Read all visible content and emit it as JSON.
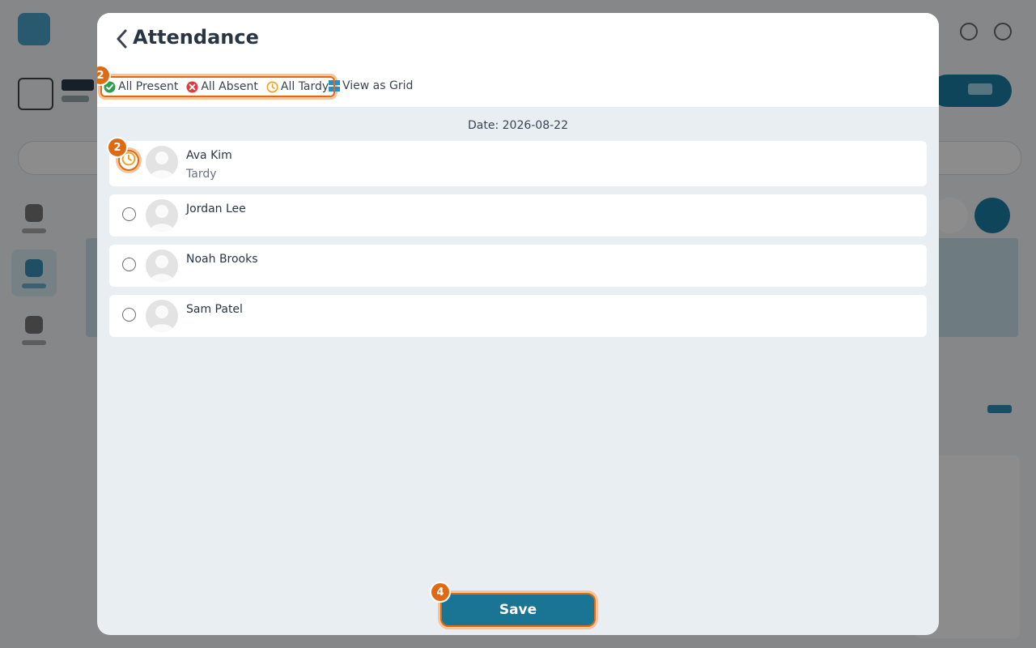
{
  "modal": {
    "title": "Attendance",
    "toolbar": {
      "all_present": "All Present",
      "all_absent": "All Absent",
      "all_tardy": "All Tardy",
      "view_as_grid": "View as Grid",
      "step_badge": "2"
    },
    "date_label": "Date: 2026-08-22",
    "students": [
      {
        "name": "Ava Kim",
        "status": "Tardy",
        "badge": "2"
      },
      {
        "name": "Jordan Lee",
        "status": ""
      },
      {
        "name": "Noah Brooks",
        "status": ""
      },
      {
        "name": "Sam Patel",
        "status": ""
      }
    ],
    "save_label": "Save",
    "save_badge": "4"
  },
  "icons": {
    "back": "chevron-left-icon",
    "present": "check-circle-icon",
    "absent": "x-circle-icon",
    "tardy": "clock-icon",
    "grid": "grid-icon"
  },
  "colors": {
    "accent": "#1a7494",
    "highlight": "#e06a12",
    "present": "#2e9e4f",
    "absent": "#e23b3b",
    "tardy": "#f0a020"
  }
}
